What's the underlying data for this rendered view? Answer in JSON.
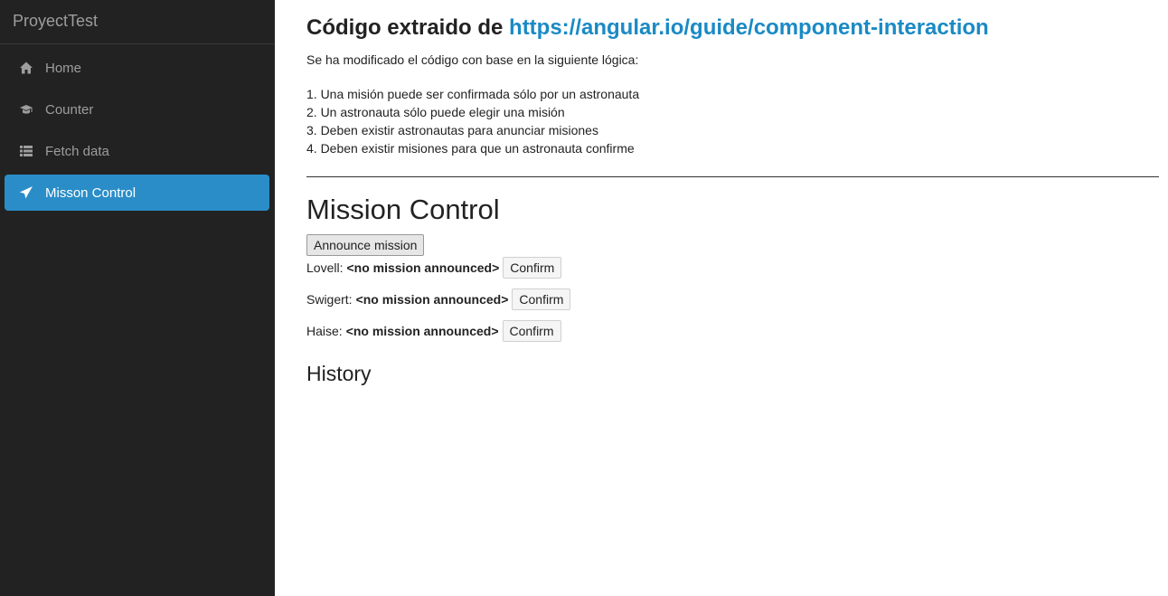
{
  "sidebar": {
    "brand": "ProyectTest",
    "items": [
      {
        "label": "Home",
        "icon": "home-icon"
      },
      {
        "label": "Counter",
        "icon": "graduation-cap-icon"
      },
      {
        "label": "Fetch data",
        "icon": "th-list-icon"
      },
      {
        "label": "Misson Control",
        "icon": "send-icon",
        "active": true
      }
    ]
  },
  "intro": {
    "title_prefix": "Código extraido de",
    "link_text": "https://angular.io/guide/component-interaction",
    "text": "Se ha modificado el código con base en la siguiente lógica:",
    "rules": [
      "1. Una misión puede ser confirmada sólo por un astronauta",
      "2. Un astronauta sólo puede elegir una misión",
      "3. Deben existir astronautas para anunciar misiones",
      "4. Deben existir misiones para que un astronauta confirme"
    ]
  },
  "mission_control": {
    "title": "Mission Control",
    "announce_label": "Announce mission",
    "astronauts": [
      {
        "name": "Lovell:",
        "mission": "<no mission announced>",
        "confirm_label": "Confirm"
      },
      {
        "name": "Swigert:",
        "mission": "<no mission announced>",
        "confirm_label": "Confirm"
      },
      {
        "name": "Haise:",
        "mission": "<no mission announced>",
        "confirm_label": "Confirm"
      }
    ],
    "history_title": "History"
  },
  "colors": {
    "sidebar_bg": "#222222",
    "active_bg": "#2a8dc8",
    "link": "#1a8ac4"
  }
}
